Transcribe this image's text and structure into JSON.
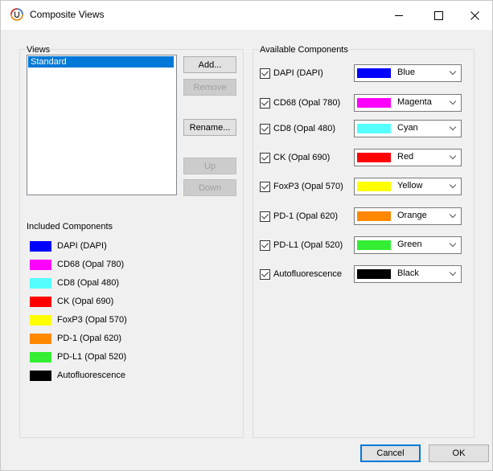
{
  "window": {
    "title": "Composite Views",
    "minimize_label": "–",
    "maximize_label": "□",
    "close_label": "✕"
  },
  "views": {
    "label": "Views",
    "items": [
      "Standard"
    ],
    "buttons": {
      "add": "Add...",
      "remove": "Remove",
      "rename": "Rename...",
      "up": "Up",
      "down": "Down"
    }
  },
  "included_components": {
    "label": "Included Components",
    "items": [
      {
        "name": "DAPI (DAPI)",
        "color": "#0000ff"
      },
      {
        "name": "CD68 (Opal 780)",
        "color": "#ff00ff"
      },
      {
        "name": "CD8 (Opal 480)",
        "color": "#55ffff"
      },
      {
        "name": "CK (Opal 690)",
        "color": "#ff0000"
      },
      {
        "name": "FoxP3 (Opal 570)",
        "color": "#ffff00"
      },
      {
        "name": "PD-1 (Opal 620)",
        "color": "#ff8800"
      },
      {
        "name": "PD-L1 (Opal 520)",
        "color": "#33ee33"
      },
      {
        "name": "Autofluorescence",
        "color": "#000000"
      }
    ]
  },
  "available_components": {
    "label": "Available Components",
    "items": [
      {
        "name": "DAPI (DAPI)",
        "checked": true,
        "color_name": "Blue",
        "color": "#0000ff"
      },
      {
        "name": "CD68 (Opal 780)",
        "checked": true,
        "color_name": "Magenta",
        "color": "#ff00ff"
      },
      {
        "name": "CD8 (Opal 480)",
        "checked": true,
        "color_name": "Cyan",
        "color": "#55ffff"
      },
      {
        "name": "CK (Opal 690)",
        "checked": true,
        "color_name": "Red",
        "color": "#ff0000"
      },
      {
        "name": "FoxP3 (Opal 570)",
        "checked": true,
        "color_name": "Yellow",
        "color": "#ffff00"
      },
      {
        "name": "PD-1 (Opal 620)",
        "checked": true,
        "color_name": "Orange",
        "color": "#ff8800"
      },
      {
        "name": "PD-L1 (Opal 520)",
        "checked": true,
        "color_name": "Green",
        "color": "#33ee33"
      },
      {
        "name": "Autofluorescence",
        "checked": true,
        "color_name": "Black",
        "color": "#000000"
      }
    ]
  },
  "footer": {
    "cancel": "Cancel",
    "ok": "OK"
  }
}
